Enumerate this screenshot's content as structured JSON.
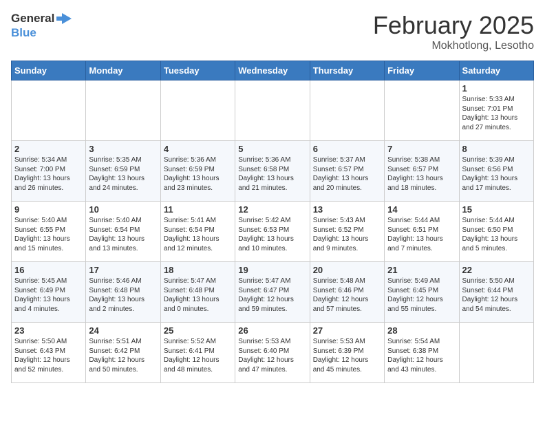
{
  "header": {
    "logo_line1": "General",
    "logo_line2": "Blue",
    "month_year": "February 2025",
    "location": "Mokhotlong, Lesotho"
  },
  "weekdays": [
    "Sunday",
    "Monday",
    "Tuesday",
    "Wednesday",
    "Thursday",
    "Friday",
    "Saturday"
  ],
  "weeks": [
    [
      {
        "day": "",
        "info": ""
      },
      {
        "day": "",
        "info": ""
      },
      {
        "day": "",
        "info": ""
      },
      {
        "day": "",
        "info": ""
      },
      {
        "day": "",
        "info": ""
      },
      {
        "day": "",
        "info": ""
      },
      {
        "day": "1",
        "info": "Sunrise: 5:33 AM\nSunset: 7:01 PM\nDaylight: 13 hours and 27 minutes."
      }
    ],
    [
      {
        "day": "2",
        "info": "Sunrise: 5:34 AM\nSunset: 7:00 PM\nDaylight: 13 hours and 26 minutes."
      },
      {
        "day": "3",
        "info": "Sunrise: 5:35 AM\nSunset: 6:59 PM\nDaylight: 13 hours and 24 minutes."
      },
      {
        "day": "4",
        "info": "Sunrise: 5:36 AM\nSunset: 6:59 PM\nDaylight: 13 hours and 23 minutes."
      },
      {
        "day": "5",
        "info": "Sunrise: 5:36 AM\nSunset: 6:58 PM\nDaylight: 13 hours and 21 minutes."
      },
      {
        "day": "6",
        "info": "Sunrise: 5:37 AM\nSunset: 6:57 PM\nDaylight: 13 hours and 20 minutes."
      },
      {
        "day": "7",
        "info": "Sunrise: 5:38 AM\nSunset: 6:57 PM\nDaylight: 13 hours and 18 minutes."
      },
      {
        "day": "8",
        "info": "Sunrise: 5:39 AM\nSunset: 6:56 PM\nDaylight: 13 hours and 17 minutes."
      }
    ],
    [
      {
        "day": "9",
        "info": "Sunrise: 5:40 AM\nSunset: 6:55 PM\nDaylight: 13 hours and 15 minutes."
      },
      {
        "day": "10",
        "info": "Sunrise: 5:40 AM\nSunset: 6:54 PM\nDaylight: 13 hours and 13 minutes."
      },
      {
        "day": "11",
        "info": "Sunrise: 5:41 AM\nSunset: 6:54 PM\nDaylight: 13 hours and 12 minutes."
      },
      {
        "day": "12",
        "info": "Sunrise: 5:42 AM\nSunset: 6:53 PM\nDaylight: 13 hours and 10 minutes."
      },
      {
        "day": "13",
        "info": "Sunrise: 5:43 AM\nSunset: 6:52 PM\nDaylight: 13 hours and 9 minutes."
      },
      {
        "day": "14",
        "info": "Sunrise: 5:44 AM\nSunset: 6:51 PM\nDaylight: 13 hours and 7 minutes."
      },
      {
        "day": "15",
        "info": "Sunrise: 5:44 AM\nSunset: 6:50 PM\nDaylight: 13 hours and 5 minutes."
      }
    ],
    [
      {
        "day": "16",
        "info": "Sunrise: 5:45 AM\nSunset: 6:49 PM\nDaylight: 13 hours and 4 minutes."
      },
      {
        "day": "17",
        "info": "Sunrise: 5:46 AM\nSunset: 6:48 PM\nDaylight: 13 hours and 2 minutes."
      },
      {
        "day": "18",
        "info": "Sunrise: 5:47 AM\nSunset: 6:48 PM\nDaylight: 13 hours and 0 minutes."
      },
      {
        "day": "19",
        "info": "Sunrise: 5:47 AM\nSunset: 6:47 PM\nDaylight: 12 hours and 59 minutes."
      },
      {
        "day": "20",
        "info": "Sunrise: 5:48 AM\nSunset: 6:46 PM\nDaylight: 12 hours and 57 minutes."
      },
      {
        "day": "21",
        "info": "Sunrise: 5:49 AM\nSunset: 6:45 PM\nDaylight: 12 hours and 55 minutes."
      },
      {
        "day": "22",
        "info": "Sunrise: 5:50 AM\nSunset: 6:44 PM\nDaylight: 12 hours and 54 minutes."
      }
    ],
    [
      {
        "day": "23",
        "info": "Sunrise: 5:50 AM\nSunset: 6:43 PM\nDaylight: 12 hours and 52 minutes."
      },
      {
        "day": "24",
        "info": "Sunrise: 5:51 AM\nSunset: 6:42 PM\nDaylight: 12 hours and 50 minutes."
      },
      {
        "day": "25",
        "info": "Sunrise: 5:52 AM\nSunset: 6:41 PM\nDaylight: 12 hours and 48 minutes."
      },
      {
        "day": "26",
        "info": "Sunrise: 5:53 AM\nSunset: 6:40 PM\nDaylight: 12 hours and 47 minutes."
      },
      {
        "day": "27",
        "info": "Sunrise: 5:53 AM\nSunset: 6:39 PM\nDaylight: 12 hours and 45 minutes."
      },
      {
        "day": "28",
        "info": "Sunrise: 5:54 AM\nSunset: 6:38 PM\nDaylight: 12 hours and 43 minutes."
      },
      {
        "day": "",
        "info": ""
      }
    ]
  ]
}
